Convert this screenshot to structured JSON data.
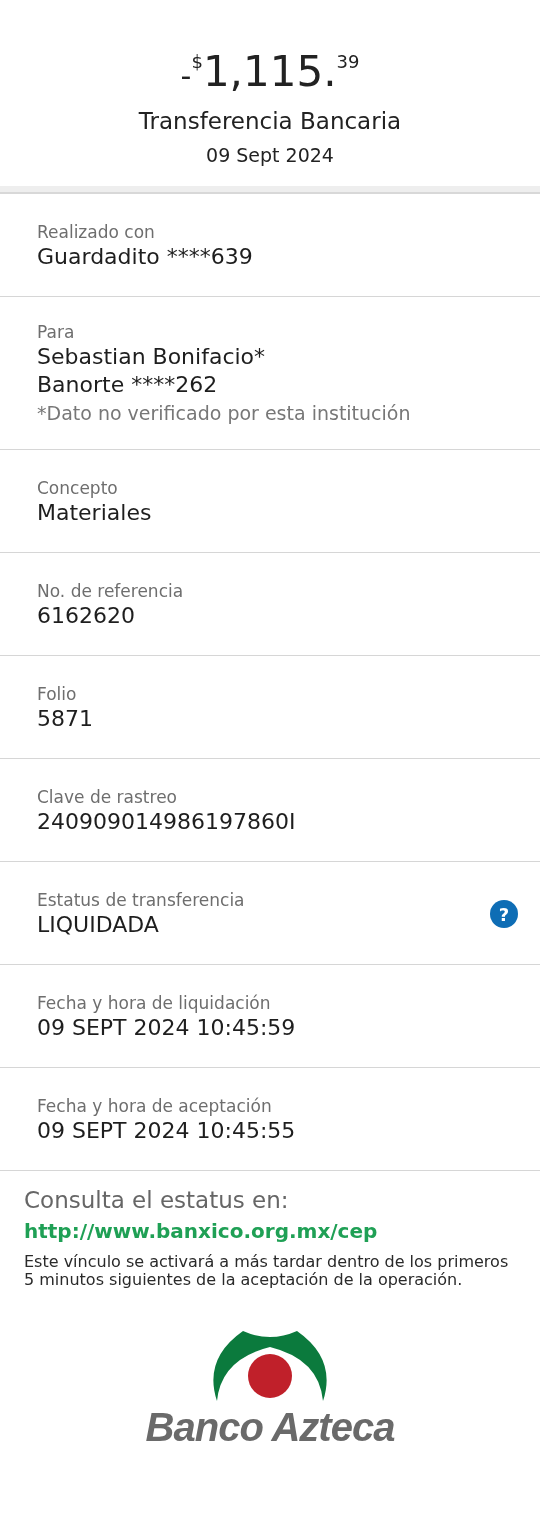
{
  "header": {
    "amount": {
      "sign": "-",
      "currency": "$",
      "whole": "1,115.",
      "cents": "39"
    },
    "title": "Transferencia Bancaria",
    "date": "09 Sept 2024"
  },
  "details": [
    {
      "label": "Realizado con",
      "values": [
        "Guardadito ****639"
      ]
    },
    {
      "label": "Para",
      "values": [
        "Sebastian Bonifacio*",
        "Banorte ****262"
      ],
      "note": "*Dato no verificado por esta institución"
    },
    {
      "label": "Concepto",
      "values": [
        "Materiales"
      ]
    },
    {
      "label": "No. de referencia",
      "values": [
        "6162620"
      ]
    },
    {
      "label": "Folio",
      "values": [
        "5871"
      ]
    },
    {
      "label": "Clave de rastreo",
      "values": [
        "240909014986197860I"
      ]
    },
    {
      "label": "Estatus de transferencia",
      "values": [
        "LIQUIDADA"
      ],
      "help": "?"
    },
    {
      "label": "Fecha y hora de liquidación",
      "values": [
        "09 SEPT 2024 10:45:59"
      ]
    },
    {
      "label": "Fecha y hora de aceptación",
      "values": [
        "09 SEPT 2024 10:45:55"
      ]
    }
  ],
  "footer": {
    "heading": "Consulta el estatus en:",
    "link": "http://www.banxico.org.mx/cep",
    "text": "Este vínculo se activará a más tardar dentro de los primeros 5 minutos siguientes de la aceptación de la operación."
  },
  "logo": {
    "text": "Banco Azteca"
  }
}
